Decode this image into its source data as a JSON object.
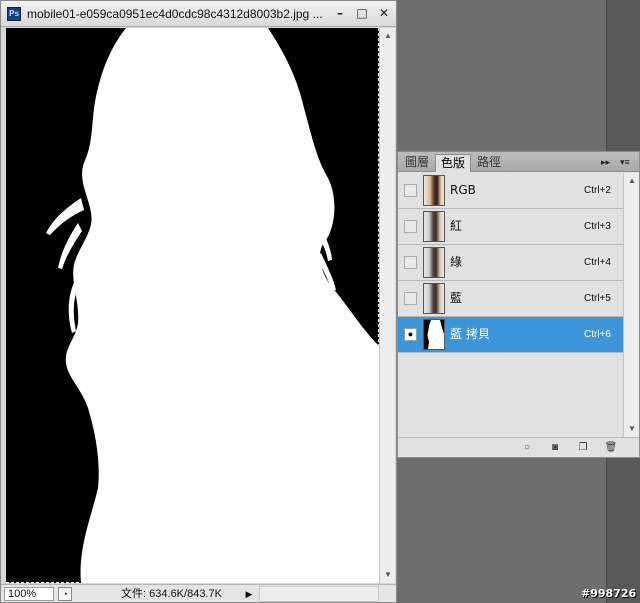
{
  "document": {
    "title": "mobile01-e059ca0951ec4d0cdc98c4312d8003b2.jpg ...",
    "zoom": "100%",
    "file_info": "文件: 634.6K/843.7K"
  },
  "window_controls": {
    "minimize": "–",
    "maximize": "□",
    "close": "✕"
  },
  "channels_panel": {
    "tabs": [
      {
        "label": "圖層",
        "active": false
      },
      {
        "label": "色版",
        "active": true
      },
      {
        "label": "路徑",
        "active": false
      }
    ],
    "collapse_icon": "▸▸",
    "menu_icon": "▾≡",
    "channels": [
      {
        "name": "RGB",
        "shortcut": "Ctrl+2",
        "visible": false,
        "selected": false,
        "thumb": "color-photo"
      },
      {
        "name": "紅",
        "shortcut": "Ctrl+3",
        "visible": false,
        "selected": false,
        "thumb": "grayscale-photo"
      },
      {
        "name": "綠",
        "shortcut": "Ctrl+4",
        "visible": false,
        "selected": false,
        "thumb": "grayscale-photo"
      },
      {
        "name": "藍",
        "shortcut": "Ctrl+5",
        "visible": false,
        "selected": false,
        "thumb": "grayscale-photo"
      },
      {
        "name": "藍 拷貝",
        "shortcut": "Ctrl+6",
        "visible": true,
        "selected": true,
        "thumb": "mask"
      }
    ],
    "footer_icons": [
      "load-selection-icon",
      "save-selection-icon",
      "new-channel-icon",
      "trash-icon"
    ]
  },
  "watermark": "#998726",
  "colors": {
    "selection_blue": "#3d95d8",
    "workspace": "#6e6e6e",
    "panel_bg": "#e1e1e1"
  }
}
